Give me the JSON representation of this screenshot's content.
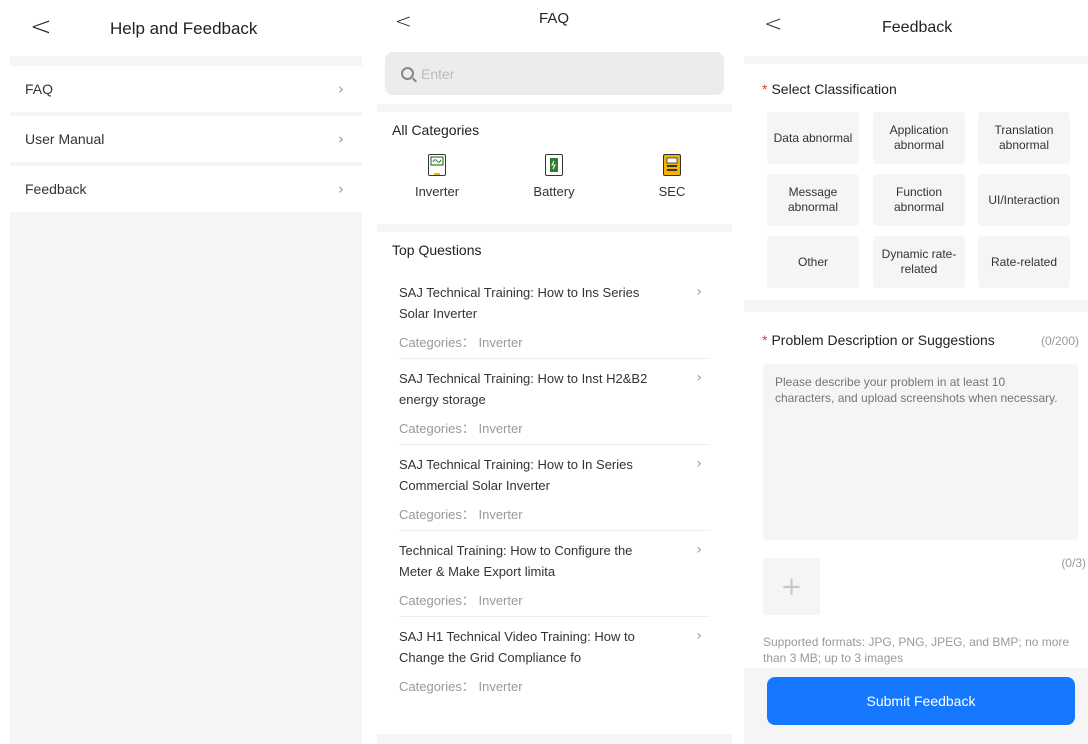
{
  "help": {
    "title": "Help and Feedback",
    "items": [
      {
        "label": "FAQ"
      },
      {
        "label": "User Manual"
      },
      {
        "label": "Feedback"
      }
    ]
  },
  "faq": {
    "title": "FAQ",
    "search_placeholder": "Enter",
    "all_categories_label": "All Categories",
    "categories": [
      {
        "label": "Inverter",
        "icon": "inverter-icon",
        "color": "#2e7d32"
      },
      {
        "label": "Battery",
        "icon": "battery-icon",
        "color": "#2e7d32"
      },
      {
        "label": "SEC",
        "icon": "sec-icon",
        "color": "#f2b400"
      }
    ],
    "top_questions_label": "Top Questions",
    "questions": [
      {
        "title": "SAJ Technical Training: How to Ins Series Solar Inverter",
        "category": "Categories： Inverter"
      },
      {
        "title": "SAJ Technical Training: How to Inst H2&B2 energy storage",
        "category": "Categories： Inverter"
      },
      {
        "title": "SAJ Technical Training: How to In Series Commercial Solar Inverter",
        "category": "Categories： Inverter"
      },
      {
        "title": "Technical Training: How to Configure the Meter & Make Export limita",
        "category": "Categories： Inverter"
      },
      {
        "title": "SAJ H1 Technical Video Training: How to Change the Grid Compliance fo",
        "category": "Categories： Inverter"
      }
    ]
  },
  "feedback": {
    "title": "Feedback",
    "classification_label": "Select Classification",
    "classifications": [
      {
        "label": "Data abnormal"
      },
      {
        "label": "Application abnormal"
      },
      {
        "label": "Translation abnormal"
      },
      {
        "label": "Message abnormal"
      },
      {
        "label": "Function abnormal"
      },
      {
        "label": "UI/Interaction"
      },
      {
        "label": "Other"
      },
      {
        "label": "Dynamic rate-related"
      },
      {
        "label": "Rate-related"
      }
    ],
    "description_label": "Problem Description or Suggestions",
    "description_counter": "(0/200)",
    "description_placeholder": "Please describe your problem in at least 10 characters, and upload screenshots when necessary.",
    "image_counter": "(0/3)",
    "formats_note": "Supported formats: JPG, PNG, JPEG, and BMP; no more than 3 MB; up to 3 images",
    "submit_label": "Submit Feedback",
    "accent_color": "#1677ff",
    "required_color": "#e53935"
  }
}
